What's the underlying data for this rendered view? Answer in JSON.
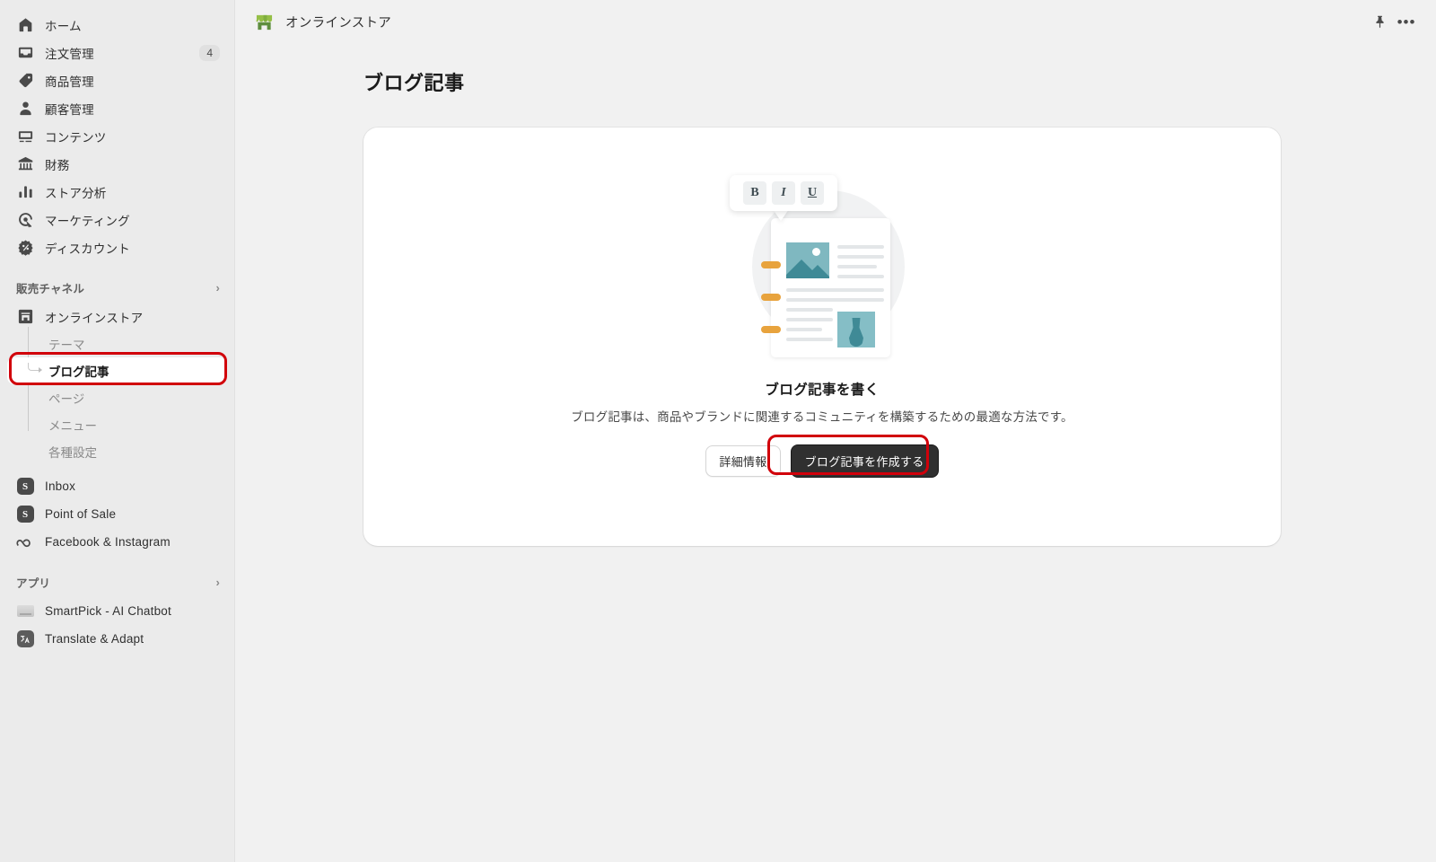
{
  "sidebar": {
    "primary_items": [
      {
        "label": "ホーム",
        "icon": "home-icon",
        "badge": null
      },
      {
        "label": "注文管理",
        "icon": "orders-inbox-icon",
        "badge": "4"
      },
      {
        "label": "商品管理",
        "icon": "tag-icon",
        "badge": null
      },
      {
        "label": "顧客管理",
        "icon": "person-icon",
        "badge": null
      },
      {
        "label": "コンテンツ",
        "icon": "content-image-icon",
        "badge": null
      },
      {
        "label": "財務",
        "icon": "bank-icon",
        "badge": null
      },
      {
        "label": "ストア分析",
        "icon": "bar-chart-icon",
        "badge": null
      },
      {
        "label": "マーケティング",
        "icon": "marketing-target-icon",
        "badge": null
      },
      {
        "label": "ディスカウント",
        "icon": "discount-percent-icon",
        "badge": null
      }
    ],
    "channels_section": {
      "label": "販売チャネル",
      "chevron": "›",
      "store_item": {
        "label": "オンラインストア",
        "icon": "storefront-icon"
      },
      "sub_items": [
        {
          "label": "テーマ",
          "active": false
        },
        {
          "label": "ブログ記事",
          "active": true
        },
        {
          "label": "ページ",
          "active": false
        },
        {
          "label": "メニュー",
          "active": false
        },
        {
          "label": "各種設定",
          "active": false
        }
      ],
      "channel_items": [
        {
          "label": "Inbox",
          "icon": "shopify-inbox-icon"
        },
        {
          "label": "Point of Sale",
          "icon": "shopify-pos-icon"
        },
        {
          "label": "Facebook & Instagram",
          "icon": "meta-icon"
        }
      ]
    },
    "apps_section": {
      "label": "アプリ",
      "chevron": "›",
      "items": [
        {
          "label": "SmartPick - AI Chatbot",
          "icon": "smartpick-app-icon"
        },
        {
          "label": "Translate & Adapt",
          "icon": "translate-adapt-icon"
        }
      ]
    }
  },
  "topbar": {
    "title": "オンラインストア",
    "store_icon": "storefront-green-icon",
    "pin_icon": "pin-icon",
    "more_icon": "more-horizontal-icon"
  },
  "page": {
    "title": "ブログ記事"
  },
  "empty_state": {
    "illustration": {
      "name": "blog-post-editor-illustration",
      "toolbar_buttons": [
        {
          "label": "B",
          "name": "bold-icon"
        },
        {
          "label": "I",
          "name": "italic-icon"
        },
        {
          "label": "U",
          "name": "underline-icon"
        }
      ]
    },
    "heading": "ブログ記事を書く",
    "description": "ブログ記事は、商品やブランドに関連するコミュニティを構築するための最適な方法です。",
    "secondary_button": "詳細情報",
    "primary_button": "ブログ記事を作成する"
  },
  "colors": {
    "annotation_red": "#d1000a",
    "primary_button_bg": "#303030",
    "sidebar_bg": "#ebebeb",
    "page_bg": "#f1f1f1",
    "illustration_teal": "#3f8a96",
    "illustration_teal_light": "#85bec6",
    "illustration_orange": "#e8a33d",
    "store_icon_green": "#95bf47"
  }
}
